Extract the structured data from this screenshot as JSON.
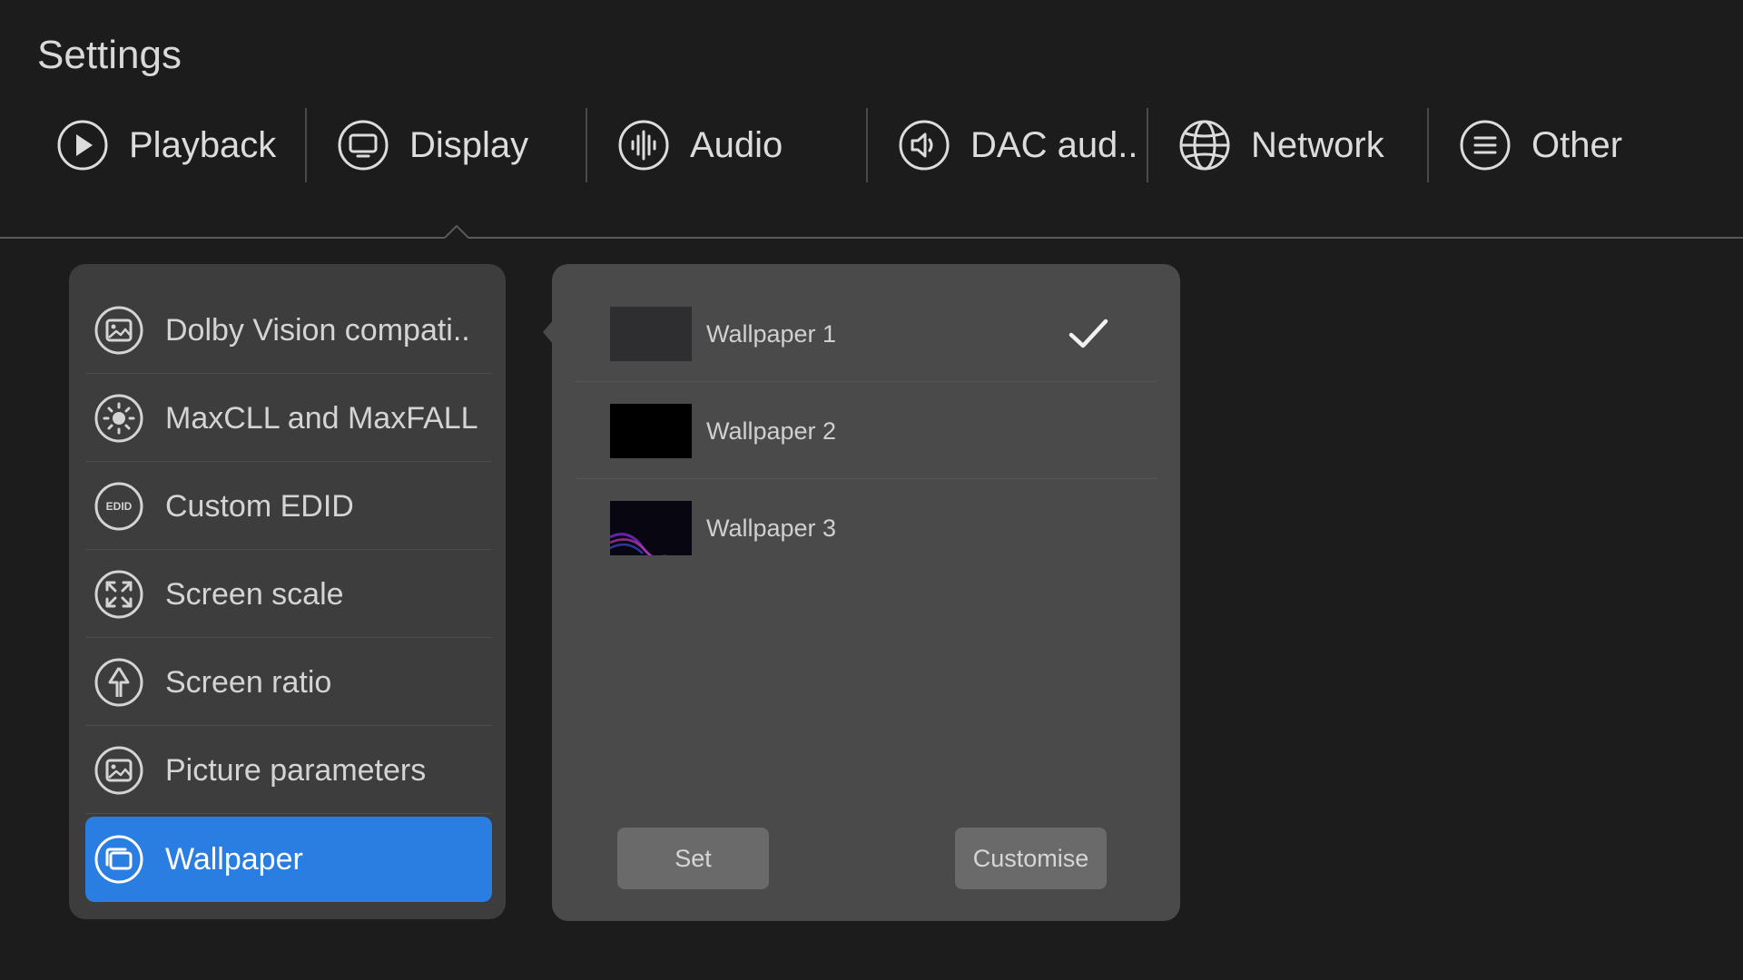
{
  "header": {
    "title": "Settings"
  },
  "tabs": [
    {
      "label": "Playback",
      "icon": "play-icon"
    },
    {
      "label": "Display",
      "icon": "monitor-icon"
    },
    {
      "label": "Audio",
      "icon": "audio-wave-icon"
    },
    {
      "label": "DAC aud..",
      "icon": "speaker-icon"
    },
    {
      "label": "Network",
      "icon": "globe-icon"
    },
    {
      "label": "Other",
      "icon": "menu-lines-icon"
    }
  ],
  "active_tab": "Display",
  "menu": {
    "items": [
      {
        "label": "Dolby Vision compati..",
        "icon": "picture-icon"
      },
      {
        "label": "MaxCLL and MaxFALL",
        "icon": "brightness-icon"
      },
      {
        "label": "Custom EDID",
        "icon": "edid-icon",
        "icon_text": "EDID"
      },
      {
        "label": "Screen scale",
        "icon": "expand-icon"
      },
      {
        "label": "Screen ratio",
        "icon": "ratio-icon"
      },
      {
        "label": "Picture parameters",
        "icon": "picture-icon"
      },
      {
        "label": "Wallpaper",
        "icon": "wallpaper-icon"
      }
    ],
    "active_item": "Wallpaper"
  },
  "wallpapers": {
    "items": [
      {
        "label": "Wallpaper 1",
        "selected": true,
        "thumb_color": "#2e2e30"
      },
      {
        "label": "Wallpaper 2",
        "selected": false,
        "thumb_color": "#000000"
      },
      {
        "label": "Wallpaper 3",
        "selected": false,
        "thumb_color": "#0a0714"
      }
    ],
    "set_label": "Set",
    "customise_label": "Customise"
  },
  "colors": {
    "background": "#1c1c1c",
    "menu_panel": "#3d3d3d",
    "content_panel": "#4a4a4a",
    "accent": "#2a7de1",
    "button": "#6a6a6a"
  }
}
